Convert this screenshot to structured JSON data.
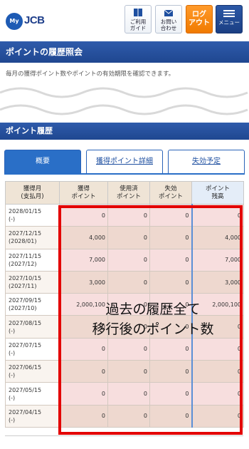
{
  "header": {
    "logo_my": "My",
    "logo_jcb": "JCB",
    "buttons": {
      "guide": [
        "ご利用",
        "ガイド"
      ],
      "contact": [
        "お問い",
        "合わせ"
      ],
      "logout": [
        "ログ",
        "アウト"
      ],
      "menu": "メニュー"
    }
  },
  "page_title": "ポイントの履歴照会",
  "description": "毎月の獲得ポイント数やポイントの有効期限を確認できます。",
  "section_title": "ポイント履歴",
  "tabs": [
    "概要",
    "獲得ポイント詳細",
    "失効予定"
  ],
  "table": {
    "headers": [
      [
        "獲得月",
        "(支払月)"
      ],
      [
        "獲得",
        "ポイント"
      ],
      [
        "使用済",
        "ポイント"
      ],
      [
        "失効",
        "ポイント"
      ],
      [
        "ポイント",
        "残高"
      ]
    ],
    "rows": [
      {
        "month": "2028/01/15",
        "pay": "(-)",
        "earned": "0",
        "used": "0",
        "expired": "0",
        "balance": "0"
      },
      {
        "month": "2027/12/15",
        "pay": "(2028/01)",
        "earned": "4,000",
        "used": "0",
        "expired": "0",
        "balance": "4,000"
      },
      {
        "month": "2027/11/15",
        "pay": "(2027/12)",
        "earned": "7,000",
        "used": "0",
        "expired": "0",
        "balance": "7,000"
      },
      {
        "month": "2027/10/15",
        "pay": "(2027/11)",
        "earned": "3,000",
        "used": "0",
        "expired": "0",
        "balance": "3,000"
      },
      {
        "month": "2027/09/15",
        "pay": "(2027/10)",
        "earned": "2,000,100",
        "used": "0",
        "expired": "0",
        "balance": "2,000,100"
      },
      {
        "month": "2027/08/15",
        "pay": "(-)",
        "earned": "0",
        "used": "0",
        "expired": "0",
        "balance": "0"
      },
      {
        "month": "2027/07/15",
        "pay": "(-)",
        "earned": "0",
        "used": "0",
        "expired": "0",
        "balance": "0"
      },
      {
        "month": "2027/06/15",
        "pay": "(-)",
        "earned": "0",
        "used": "0",
        "expired": "0",
        "balance": "0"
      },
      {
        "month": "2027/05/15",
        "pay": "(-)",
        "earned": "0",
        "used": "0",
        "expired": "0",
        "balance": "0"
      },
      {
        "month": "2027/04/15",
        "pay": "(-)",
        "earned": "0",
        "used": "0",
        "expired": "0",
        "balance": "0"
      }
    ]
  },
  "annotation": [
    "過去の履歴全て",
    "移行後のポイント数"
  ],
  "colors": {
    "brand_blue": "#1f4790",
    "logout_orange": "#f07a00",
    "highlight_red": "#e30000"
  }
}
